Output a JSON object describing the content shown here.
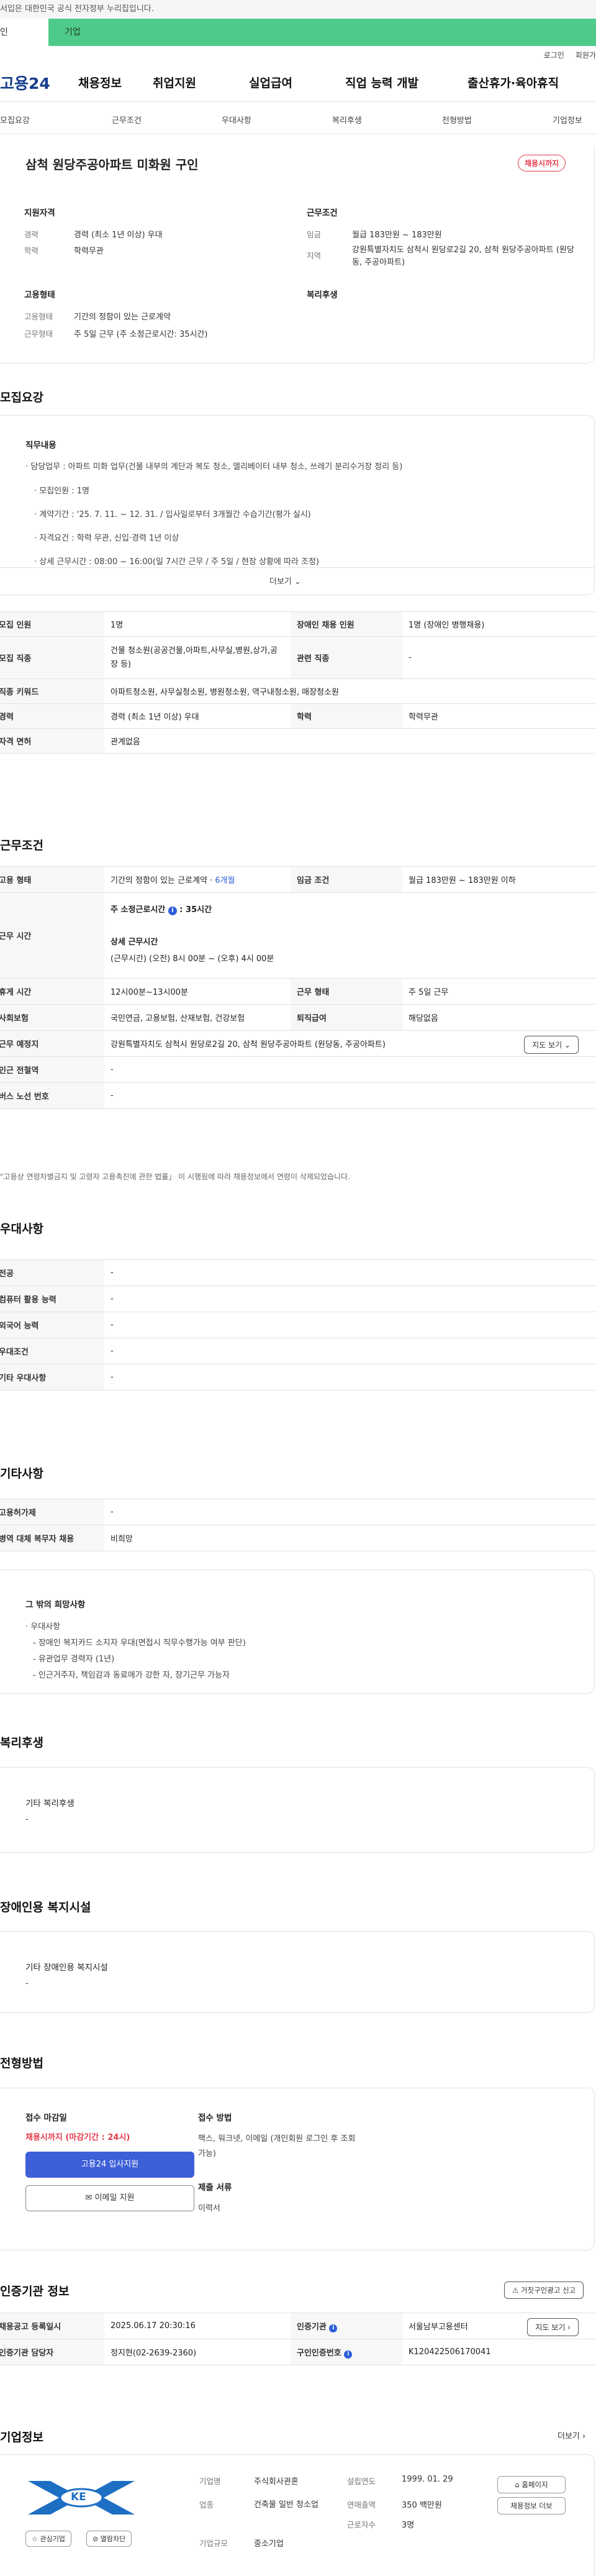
{
  "gov_strip": "서입은 대한민국 공식 전자정부 누리집입니다.",
  "green_bar": {
    "lead": "인",
    "label": "기업"
  },
  "login_row": [
    "로그인",
    "회원가"
  ],
  "gnb": {
    "logo": "고용24",
    "menus": [
      "채용정보",
      "취업지원",
      "실업급여",
      "직업 능력 개발",
      "출산휴가·육아휴직"
    ]
  },
  "lnb": [
    "모집요강",
    "근무조건",
    "우대사항",
    "복리후생",
    "전형방법",
    "기업정보"
  ],
  "header_card": {
    "title": "삼척 원당주공아파트 미화원 구인",
    "status_badge": "채용시까지",
    "qual_title": "지원자격",
    "qual": [
      {
        "k": "경력",
        "v": "경력 (최소 1년 이상) 우대"
      },
      {
        "k": "학력",
        "v": "학력무관"
      }
    ],
    "cond_title": "근무조건",
    "cond": [
      {
        "k": "임금",
        "v": "월급 183만원 ~ 183만원"
      },
      {
        "k": "지역",
        "v": "강원특별자치도 삼척시 원당로2길 20, 삼척 원당주공아파트 (원당동, 주공아파트)"
      }
    ],
    "emp_title": "고용형태",
    "emp": [
      {
        "k": "고용형태",
        "v": "기간의 정함이 있는 근로계약"
      },
      {
        "k": "근무형태",
        "v": "주 5일 근무 (주 소정근로시간: 35시간)"
      }
    ],
    "welfare_title": "복리후생"
  },
  "recruit": {
    "title": "모집요강",
    "job_title": "직무내용",
    "lines": [
      "· 담당업무 : 아파트 미화 업무(건물 내부의 계단과 복도 청소, 엘리베이터 내부 청소, 쓰레기 분리수거장 정리 등)",
      "· 모집인원 : 1명",
      "· 계약기간 : '25. 7. 11. ~ 12. 31. / 입사일로부터 3개월간 수습기간(평가 실시)",
      "· 자격요건 : 학력 무관, 신입·경력 1년 이상",
      "· 상세 근무시간 : 08:00 ~ 16:00(일 7시간 근무 / 주 5일 / 현장 상황에 따라 조정)"
    ],
    "more": "더보기 ⌄",
    "table": [
      {
        "k1": "모집 인원",
        "v1": "1명",
        "k2": "장애인 채용 인원",
        "v2": "1명 (장애인 병행채용)"
      },
      {
        "k1": "모집 직종",
        "v1": "건물 청소원(공공건물,아파트,사무실,병원,상가,공장 등)",
        "k2": "관련 직종",
        "v2": "-"
      },
      {
        "k1": "직종 키워드",
        "v1": "아파트청소원, 사무실청소원, 병원청소원, 역구내청소원, 매장청소원",
        "k2": "",
        "v2": ""
      },
      {
        "k1": "경력",
        "v1": "경력 (최소 1년 이상) 우대",
        "k2": "학력",
        "v2": "학력무관"
      },
      {
        "k1": "자격 면허",
        "v1": "관계없음",
        "k2": "",
        "v2": ""
      }
    ]
  },
  "workcond": {
    "title": "근무조건",
    "emp_type_k": "고용 형태",
    "emp_type_v": "기간의 정함이 있는 근로계약 · ",
    "emp_type_months": "6개월",
    "wage_k": "임금 조건",
    "wage_v": "월급 183만원 ~ 183만원 이하",
    "time_k": "근무 시간",
    "time_main": "주 소정근로시간",
    "time_hours": "35시간",
    "time_detail_title": "상세 근무시간",
    "time_detail": "(근무시간) (오전) 8시 00분 ~ (오후) 4시 00분",
    "rest_k": "휴게 시간",
    "rest_v": "12시00분~13시00분",
    "form_k": "근무 형태",
    "form_v": "주 5일 근무",
    "ins_k": "사회보험",
    "ins_v": "국민연금, 고용보험, 산재보험, 건강보험",
    "ret_k": "퇴직급여",
    "ret_v": "해당없음",
    "place_k": "근무 예정지",
    "place_v": "강원특별자치도 삼척시 원당로2길 20, 삼척 원당주공아파트 (원당동, 주공아파트)",
    "map_btn": "지도 보기 ⌄",
    "subway_k": "인근 전철역",
    "subway_v": "-",
    "bus_k": "버스 노선 번호",
    "bus_v": "-",
    "note": "\"고용상 연령차별금지 및 고령자 고용촉진에 관한 법률」 이 시행됨에 따라 채용정보에서 연령이 삭제되었습니다."
  },
  "pref": {
    "title": "우대사항",
    "rows": [
      {
        "k": "전공",
        "v": "-"
      },
      {
        "k": "컴퓨터 활용 능력",
        "v": "-"
      },
      {
        "k": "외국어 능력",
        "v": "-"
      },
      {
        "k": "우대조건",
        "v": "-"
      },
      {
        "k": "기타 우대사항",
        "v": "-"
      }
    ]
  },
  "etc": {
    "title": "기타사항",
    "rows": [
      {
        "k": "고용허가제",
        "v": "-"
      },
      {
        "k": "병역 대체 복무자 채용",
        "v": "비희망"
      }
    ],
    "box_title": "그 밖의 희망사항",
    "box_lines": [
      "· 우대사항",
      "  - 장애인 복지카드 소지자 우대(면접시 직무수행가능 여부 판단)",
      "  - 유관업무 경력자 (1년)",
      "  - 인근거주자, 책임감과 동료애가 강한 자, 장기근무 가능자"
    ]
  },
  "welfare": {
    "title": "복리후생",
    "box_title": "기타 복리후생",
    "box_val": "-"
  },
  "disability": {
    "title": "장애인용 복지시설",
    "box_title": "기타 장애인용 복지시설",
    "box_val": "-"
  },
  "screening": {
    "title": "전형방법",
    "deadline_title": "접수 마감일",
    "deadline_val": "채용시까지 (마감기간 : 24시)",
    "apply_btn": "고용24 입사지원",
    "email_btn": "이메일 지원",
    "method_title": "접수 방법",
    "method_val": "팩스, 워크넷, 이메일 (개인회원 로그인 후 조회가능)",
    "docs_title": "제출 서류",
    "docs_val": "이력서"
  },
  "agency": {
    "title": "인증기관 정보",
    "report_btn": "거짓구인광고 신고",
    "rows": [
      {
        "k1": "채용공고 등록일시",
        "v1": "2025.06.17 20:30:16",
        "k2": "인증기관",
        "v2": "서울남부고용센터",
        "btn": "지도 보기 ›"
      },
      {
        "k1": "인증기관 담당자",
        "v1": "정지현(02-2639-2360)",
        "k2": "구인인증번호",
        "v2": "K120422506170041",
        "btn": ""
      }
    ]
  },
  "company": {
    "title": "기업정보",
    "more": "더보기 ›",
    "logo_text": "KE",
    "interest_btn": "관심기업",
    "block_btn": "열람차단",
    "info": [
      {
        "k": "기업명",
        "v": "주식회사관혼"
      },
      {
        "k": "업종",
        "v": "건축물 일반 청소업"
      },
      {
        "k": "기업규모",
        "v": "중소기업"
      }
    ],
    "info2": [
      {
        "k": "설립연도",
        "v": "1999. 01. 29"
      },
      {
        "k": "연매출액",
        "v": "350 백만원"
      },
      {
        "k": "근로자수",
        "v": "3명"
      }
    ],
    "homepage_btn": "홈페이지",
    "jobs_btn": "채용정보 더보"
  }
}
